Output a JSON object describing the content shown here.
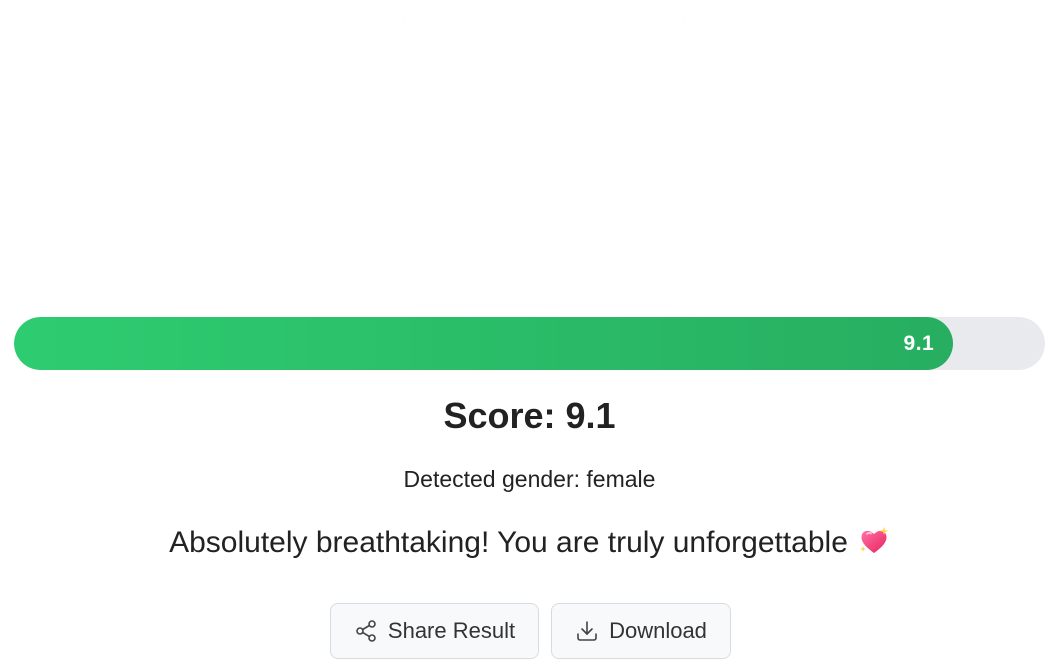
{
  "result": {
    "score_fraction": 0.911,
    "bar_label": "9.1",
    "score_heading": "Score: 9.1",
    "gender_text": "Detected gender: female",
    "message": "Absolutely breathtaking! You are truly unforgettable",
    "message_emoji": "sparkling-heart-icon"
  },
  "actions": {
    "share_label": "Share Result",
    "share_icon": "share-icon",
    "download_label": "Download",
    "download_icon": "download-icon"
  },
  "colors": {
    "bar_start": "#2ecc71",
    "bar_end": "#27ae60",
    "track": "#e8eaed"
  }
}
